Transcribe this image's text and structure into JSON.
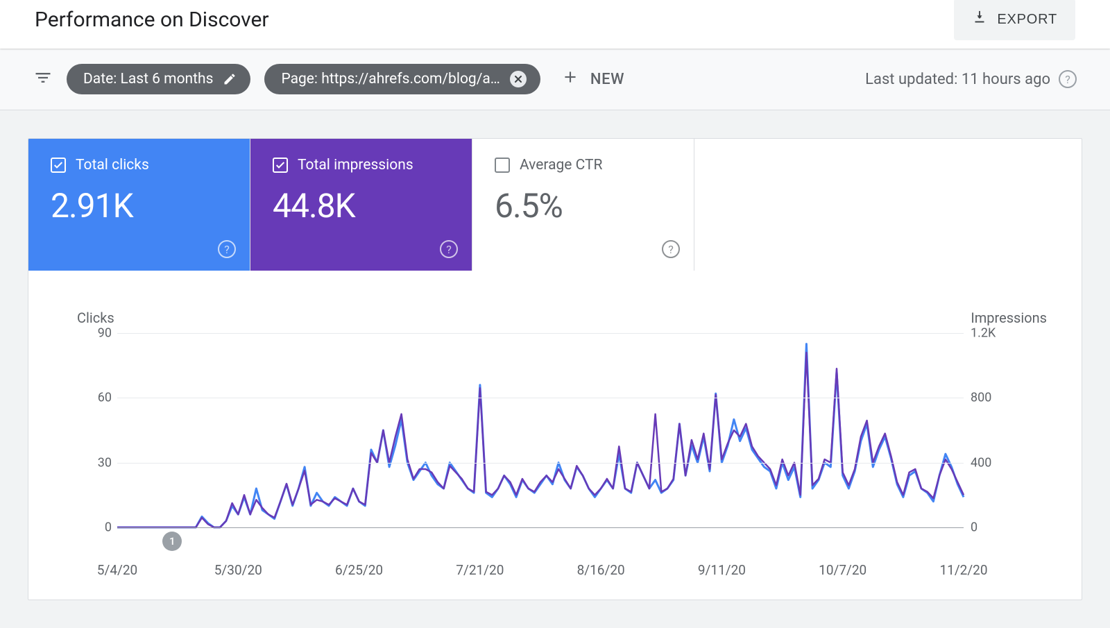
{
  "header": {
    "title": "Performance on Discover",
    "export_label": "EXPORT"
  },
  "filters": {
    "date_chip": "Date: Last 6 months",
    "page_chip": "Page: https://ahrefs.com/blog/a…",
    "new_label": "NEW",
    "updated_label": "Last updated: 11 hours ago"
  },
  "metrics": {
    "clicks": {
      "label": "Total clicks",
      "value": "2.91K",
      "checked": true
    },
    "impressions": {
      "label": "Total impressions",
      "value": "44.8K",
      "checked": true
    },
    "ctr": {
      "label": "Average CTR",
      "value": "6.5%",
      "checked": false
    }
  },
  "chart_data": {
    "type": "line",
    "left_axis": {
      "title": "Clicks",
      "ticks": [
        0,
        30,
        60,
        90
      ],
      "range": [
        0,
        90
      ]
    },
    "right_axis": {
      "title": "Impressions",
      "ticks": [
        "0",
        "400",
        "800",
        "1.2K"
      ],
      "range": [
        0,
        1200
      ]
    },
    "x_ticks": [
      "5/4/20",
      "5/30/20",
      "6/25/20",
      "7/21/20",
      "8/16/20",
      "9/11/20",
      "10/7/20",
      "11/2/20"
    ],
    "annotations": [
      {
        "label": "1",
        "x_frac": 0.065
      }
    ],
    "series": [
      {
        "name": "Clicks",
        "axis": "left",
        "color": "#4285f4",
        "y": [
          0,
          0,
          0,
          0,
          0,
          0,
          0,
          0,
          0,
          0,
          0,
          0,
          0,
          0,
          5,
          2,
          0,
          0,
          3,
          10,
          6,
          14,
          6,
          18,
          8,
          6,
          4,
          12,
          20,
          10,
          18,
          28,
          10,
          16,
          12,
          10,
          14,
          12,
          10,
          18,
          12,
          10,
          36,
          30,
          45,
          28,
          38,
          50,
          30,
          22,
          26,
          30,
          24,
          20,
          18,
          30,
          26,
          22,
          18,
          16,
          66,
          16,
          14,
          18,
          24,
          20,
          14,
          22,
          18,
          16,
          20,
          24,
          20,
          30,
          22,
          18,
          28,
          24,
          18,
          14,
          18,
          22,
          18,
          34,
          18,
          16,
          30,
          24,
          18,
          22,
          16,
          18,
          22,
          48,
          24,
          38,
          30,
          42,
          26,
          62,
          30,
          38,
          50,
          40,
          46,
          36,
          32,
          28,
          26,
          18,
          30,
          22,
          28,
          14,
          85,
          18,
          22,
          30,
          28,
          72,
          24,
          18,
          26,
          40,
          48,
          28,
          36,
          42,
          32,
          20,
          14,
          24,
          26,
          18,
          16,
          12,
          24,
          34,
          28,
          20,
          14
        ]
      },
      {
        "name": "Impressions",
        "axis": "right",
        "color": "#673ab7",
        "y": [
          0,
          0,
          0,
          0,
          0,
          0,
          0,
          0,
          0,
          0,
          0,
          0,
          0,
          0,
          60,
          20,
          0,
          0,
          40,
          150,
          80,
          200,
          80,
          170,
          120,
          80,
          60,
          160,
          270,
          140,
          240,
          350,
          140,
          170,
          160,
          140,
          180,
          160,
          140,
          240,
          160,
          140,
          460,
          400,
          600,
          400,
          560,
          700,
          420,
          300,
          360,
          360,
          340,
          280,
          240,
          380,
          340,
          300,
          240,
          220,
          860,
          220,
          200,
          240,
          320,
          280,
          200,
          300,
          240,
          220,
          280,
          320,
          280,
          360,
          300,
          240,
          380,
          320,
          240,
          200,
          240,
          300,
          240,
          500,
          240,
          220,
          400,
          320,
          240,
          700,
          220,
          240,
          300,
          640,
          320,
          540,
          420,
          580,
          360,
          820,
          420,
          520,
          600,
          560,
          640,
          500,
          440,
          400,
          360,
          260,
          420,
          320,
          400,
          200,
          1080,
          260,
          300,
          420,
          400,
          980,
          340,
          260,
          360,
          560,
          660,
          400,
          500,
          580,
          440,
          280,
          200,
          340,
          360,
          240,
          220,
          180,
          320,
          420,
          360,
          280,
          200
        ]
      }
    ]
  }
}
